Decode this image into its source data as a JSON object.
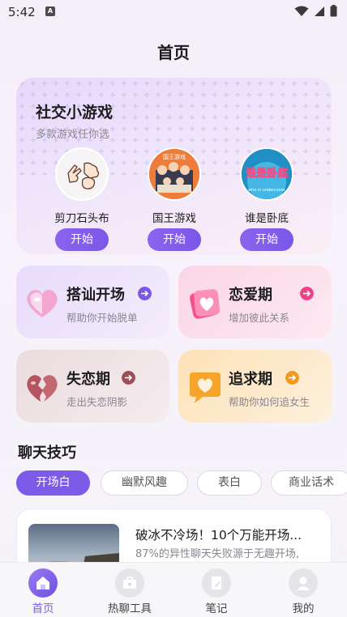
{
  "status_bar": {
    "time": "5:42",
    "notification_icon": "A"
  },
  "header": {
    "title": "首页"
  },
  "games": {
    "title": "社交小游戏",
    "subtitle": "多款游戏任你选",
    "items": [
      {
        "name": "剪刀石头布",
        "button": "开始",
        "icon": "rock-paper-scissors-icon"
      },
      {
        "name": "国王游戏",
        "button": "开始",
        "icon": "king-game-icon",
        "avatar_caption": "国王游戏"
      },
      {
        "name": "谁是卧底",
        "button": "开始",
        "icon": "undercover-icon",
        "avatar_caption": "谁是卧底",
        "avatar_subcaption": "who is undercover"
      }
    ]
  },
  "stages": [
    {
      "title": "搭讪开场",
      "subtitle": "帮助你开始脱单",
      "icon": "heart-bubble-icon",
      "arrow_color": "#7b57e8"
    },
    {
      "title": "恋爱期",
      "subtitle": "增加彼此关系",
      "icon": "heart-card-icon",
      "arrow_color": "#f0418b"
    },
    {
      "title": "失恋期",
      "subtitle": "走出失恋阴影",
      "icon": "broken-heart-icon",
      "arrow_color": "#9e4e58"
    },
    {
      "title": "追求期",
      "subtitle": "帮助你如何追女生",
      "icon": "heart-chat-icon",
      "arrow_color": "#f39a1c"
    }
  ],
  "chat_skills": {
    "title": "聊天技巧",
    "chips": [
      "开场白",
      "幽默风趣",
      "表白",
      "商业话术"
    ],
    "active_chip": "开场白"
  },
  "article": {
    "title": "破冰不冷场！10个万能开场...",
    "desc": "87%的异性聊天失败源于无趣开场,"
  },
  "bottom_nav": {
    "items": [
      {
        "label": "首页",
        "icon": "home-icon"
      },
      {
        "label": "热聊工具",
        "icon": "toolbox-icon"
      },
      {
        "label": "笔记",
        "icon": "notebook-icon"
      },
      {
        "label": "我的",
        "icon": "user-icon"
      }
    ],
    "active": "首页"
  },
  "colors": {
    "accent": "#7c5be9",
    "text": "#1d1d1f",
    "muted": "#8a8590"
  }
}
